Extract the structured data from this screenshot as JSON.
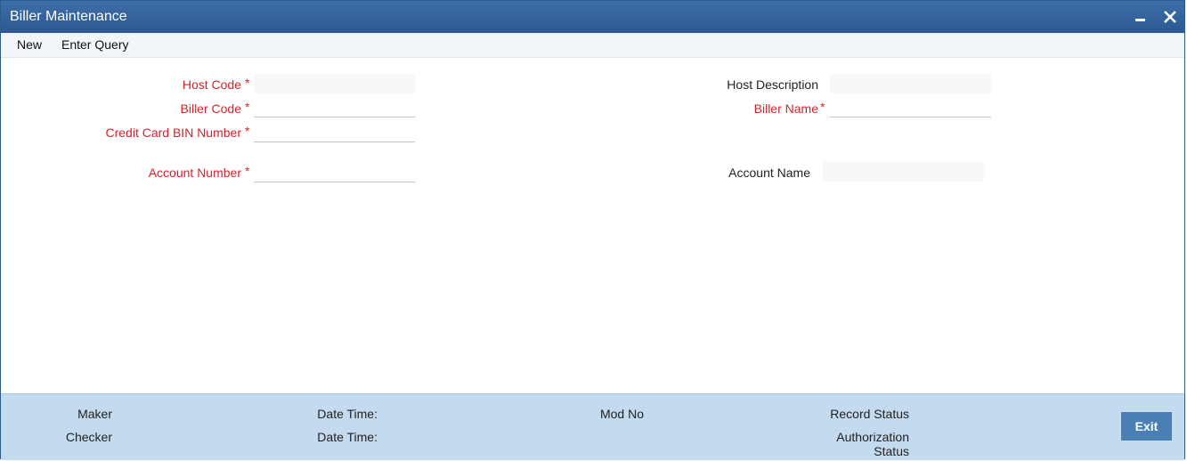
{
  "window": {
    "title": "Biller Maintenance",
    "colors": {
      "titlebar": "#2b5892",
      "footer": "#c3daef",
      "required_label": "#d8212c",
      "exit_button": "#4a7fb3"
    }
  },
  "toolbar": {
    "new_label": "New",
    "enter_query_label": "Enter Query"
  },
  "form": {
    "host_code": {
      "label": "Host Code",
      "value": ""
    },
    "biller_code": {
      "label": "Biller Code",
      "value": ""
    },
    "credit_card_bin": {
      "label": "Credit Card BIN Number",
      "value": ""
    },
    "account_number": {
      "label": "Account Number",
      "value": ""
    },
    "host_description": {
      "label": "Host Description",
      "value": ""
    },
    "biller_name": {
      "label": "Biller Name",
      "value": ""
    },
    "account_name": {
      "label": "Account Name",
      "value": ""
    },
    "required_marker": "*"
  },
  "footer": {
    "maker": "Maker",
    "checker": "Checker",
    "date_time_1": "Date Time:",
    "date_time_2": "Date Time:",
    "mod_no": "Mod No",
    "record_status": "Record Status",
    "authorization_status_line1": "Authorization",
    "authorization_status_line2": "Status",
    "exit_label": "Exit"
  }
}
